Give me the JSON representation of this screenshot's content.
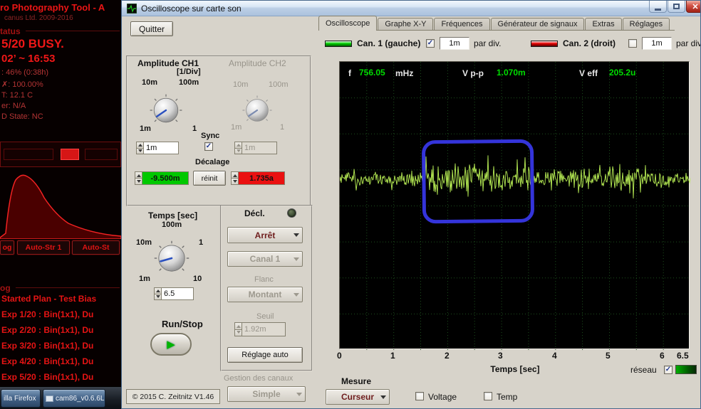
{
  "icons": {
    "close": "✕",
    "check": "✓",
    "play": "▶"
  },
  "colors": {
    "ch1": "#00cf00",
    "ch2": "#e60000",
    "trace": "#b9ef55",
    "grid": "#1d4f1d",
    "annotation": "#3434da",
    "readout_green": "#00dc00",
    "offset_pos_bg": "#00c800",
    "offset_neg_bg": "#ea1010"
  },
  "apt": {
    "title": "ro Photography Tool - A",
    "subtitle": "canus Ltd. 2009-2016",
    "status_header": "tatus",
    "busy_line": "5/20 BUSY.",
    "time_line": "02’  ~  16:53",
    "info_lines": [
      ": 46% (0:38h)",
      "✗: 100.00%",
      "T: 12.1 C",
      "er: N/A",
      "D State: NC"
    ],
    "toolbar_buttons": [
      "og",
      "Auto-Str 1",
      "Auto-St"
    ],
    "log_header": "og",
    "log_lines": [
      "Started Plan - Test Bias",
      "Exp 1/20 : Bin(1x1), Du",
      "Exp 2/20 : Bin(1x1), Du",
      "Exp 3/20 : Bin(1x1), Du",
      "Exp 4/20 : Bin(1x1), Du",
      "Exp 5/20 : Bin(1x1), Du"
    ],
    "taskbar": {
      "firefox": "illa Firefox",
      "cam86": "cam86_v0.6.6L..."
    }
  },
  "window": {
    "title": "Oscilloscope sur carte son",
    "quit": "Quitter",
    "copyright": "© 2015   C. Zeitnitz V1.46"
  },
  "tabs": [
    {
      "label": "Oscilloscope",
      "active": true
    },
    {
      "label": "Graphe X-Y",
      "active": false
    },
    {
      "label": "Fréquences",
      "active": false
    },
    {
      "label": "Générateur de signaux",
      "active": false
    },
    {
      "label": "Extras",
      "active": false
    },
    {
      "label": "Réglages",
      "active": false
    }
  ],
  "channel_bar": {
    "ch1_label": "Can. 1 (gauche)",
    "ch1_scale": "1m",
    "ch1_per_div": "par div.",
    "ch1_checked": true,
    "ch2_label": "Can. 2 (droit)",
    "ch2_scale": "1m",
    "ch2_per_div": "par div.",
    "ch2_checked": false
  },
  "amplitude": {
    "ch1_title": "Amplitude CH1",
    "ch2_title": "Amplitude CH2",
    "unit_label": "[1/Div]",
    "tick_left": "10m",
    "tick_top": "100m",
    "tick_bottom_left": "1m",
    "tick_bottom_right": "1",
    "sync_label": "Sync",
    "ch1_value": "1m",
    "ch2_value": "1m",
    "offset_label": "Décalage",
    "ch1_offset": "-9.500m",
    "reset_label": "réinit",
    "ch2_offset": "1.735a"
  },
  "time_base": {
    "title": "Temps [sec]",
    "tick_top": "100m",
    "tick_left": "10m",
    "tick_right": "1",
    "tick_bottom_left": "1m",
    "tick_bottom_right": "10",
    "value": "6.5",
    "run_stop_label": "Run/Stop"
  },
  "trigger": {
    "title": "Décl.",
    "mode": "Arrêt",
    "source": "Canal 1",
    "edge_label": "Flanc",
    "edge": "Montant",
    "threshold_label": "Seuil",
    "threshold": "1.92m",
    "auto_label": "Réglage auto",
    "mgmt_label": "Gestion des canaux",
    "mgmt_value": "Simple"
  },
  "display": {
    "f_label": "f",
    "f_value": "756.05",
    "f_unit": "mHz",
    "vpp_label": "V p-p",
    "vpp_value": "1.070m",
    "veff_label": "V eff",
    "veff_value": "205.2u",
    "x_ticks": [
      "0",
      "1",
      "2",
      "3",
      "4",
      "5",
      "6",
      "6.5"
    ],
    "x_axis_label": "Temps [sec]",
    "reseau_label": "réseau"
  },
  "measure": {
    "title": "Mesure",
    "cursor_value": "Curseur",
    "voltage_label": "Voltage",
    "temp_label": "Temp"
  }
}
